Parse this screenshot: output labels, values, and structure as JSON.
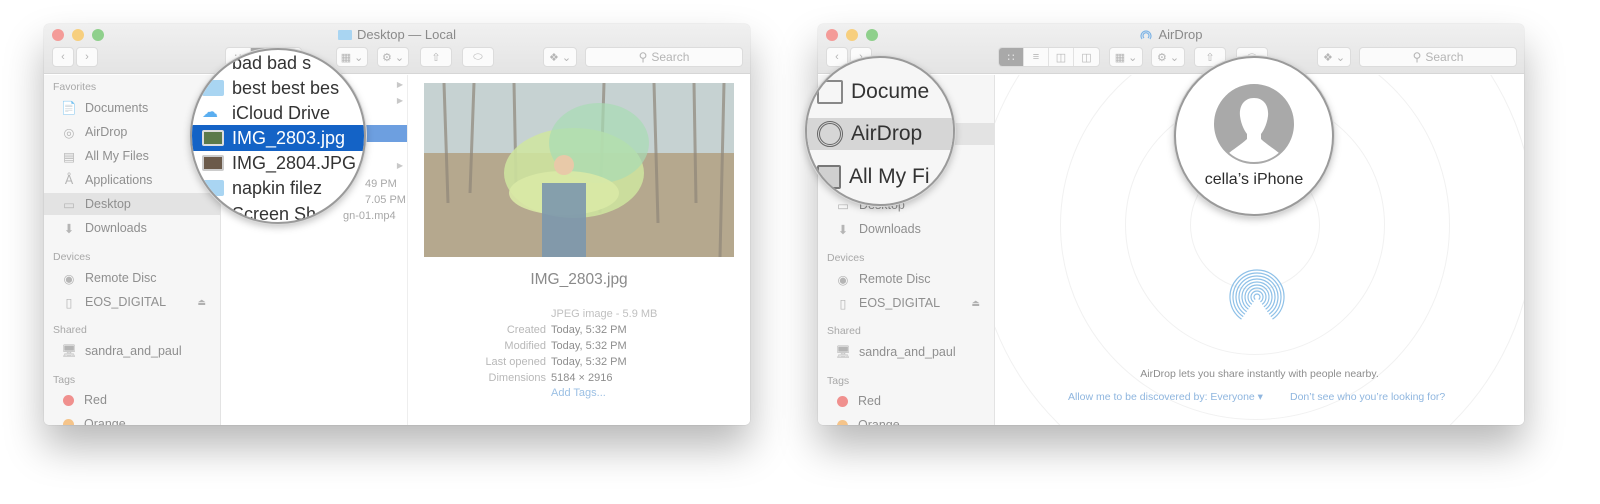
{
  "left_window": {
    "title": "Desktop — Local",
    "search_placeholder": "Search",
    "sidebar": {
      "favorites_heading": "Favorites",
      "favorites": [
        {
          "label": "Documents",
          "icon": "documents-icon"
        },
        {
          "label": "AirDrop",
          "icon": "airdrop-icon"
        },
        {
          "label": "All My Files",
          "icon": "all-my-files-icon"
        },
        {
          "label": "Applications",
          "icon": "applications-icon"
        },
        {
          "label": "Desktop",
          "icon": "desktop-icon",
          "selected": true
        },
        {
          "label": "Downloads",
          "icon": "downloads-icon"
        }
      ],
      "devices_heading": "Devices",
      "devices": [
        {
          "label": "Remote Disc",
          "icon": "disc-icon"
        },
        {
          "label": "EOS_DIGITAL",
          "icon": "drive-icon",
          "eject": true
        }
      ],
      "shared_heading": "Shared",
      "shared": [
        {
          "label": "sandra_and_paul",
          "icon": "computer-icon"
        }
      ],
      "tags_heading": "Tags",
      "tags": [
        {
          "label": "Red",
          "color": "#f0908e"
        },
        {
          "label": "Orange",
          "color": "#f5c48a"
        }
      ]
    },
    "files": [
      {
        "name": "bad bad s",
        "type": "folder"
      },
      {
        "name": "best best bes",
        "type": "folder",
        "has_children": true
      },
      {
        "name": "iCloud Drive",
        "type": "icloud",
        "has_children": true
      },
      {
        "name": "IMG_2803.jpg",
        "type": "image",
        "selected": true
      },
      {
        "name": "IMG_2804.JPG",
        "type": "image"
      },
      {
        "name": "napkin filez",
        "type": "folder",
        "has_children": true
      },
      {
        "name": "Screen Sh",
        "type": "video"
      }
    ],
    "file_fragments": [
      "49 PM",
      "7.05 PM",
      "gn-01.mp4"
    ],
    "preview": {
      "filename": "IMG_2803.jpg",
      "kind": "JPEG image - 5.9 MB",
      "rows": [
        {
          "label": "Created",
          "value": "Today, 5:32 PM"
        },
        {
          "label": "Modified",
          "value": "Today, 5:32 PM"
        },
        {
          "label": "Last opened",
          "value": "Today, 5:32 PM"
        },
        {
          "label": "Dimensions",
          "value": "5184 × 2916"
        }
      ],
      "add_tags": "Add Tags..."
    }
  },
  "right_window": {
    "title": "AirDrop",
    "search_placeholder": "Search",
    "sidebar": {
      "magnified": [
        {
          "label": "Docume",
          "icon": "documents-icon"
        },
        {
          "label": "AirDrop",
          "icon": "airdrop-icon",
          "selected": true
        },
        {
          "label": "All My Fi",
          "icon": "all-my-files-icon"
        }
      ],
      "favorites": [
        {
          "label": "Desktop",
          "icon": "desktop-icon"
        },
        {
          "label": "Downloads",
          "icon": "downloads-icon"
        }
      ],
      "devices_heading": "Devices",
      "devices": [
        {
          "label": "Remote Disc",
          "icon": "disc-icon"
        },
        {
          "label": "EOS_DIGITAL",
          "icon": "drive-icon",
          "eject": true
        }
      ],
      "shared_heading": "Shared",
      "shared": [
        {
          "label": "sandra_and_paul",
          "icon": "computer-icon"
        }
      ],
      "tags_heading": "Tags",
      "tags": [
        {
          "label": "Red",
          "color": "#f0908e"
        },
        {
          "label": "Orange",
          "color": "#f5c48a"
        }
      ]
    },
    "device_name": "cella’s iPhone",
    "airdrop_description": "AirDrop lets you share instantly with people nearby.",
    "discover_link": "Allow me to be discovered by: Everyone ▾",
    "help_link": "Don’t see who you’re looking for?",
    "accent_color": "#8fb6df"
  }
}
